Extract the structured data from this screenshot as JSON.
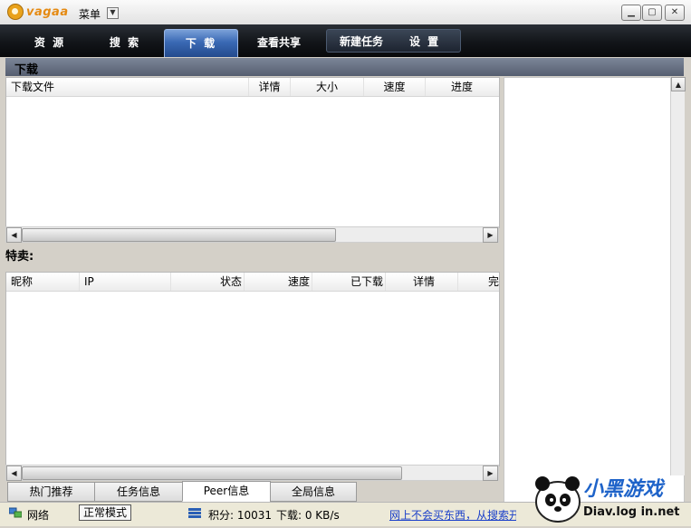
{
  "titlebar": {
    "logo_text": "vagaa",
    "menu_label": "菜单"
  },
  "nav": {
    "tabs": [
      "资 源",
      "搜 索",
      "下 载",
      "查看共享"
    ],
    "active_index": 2,
    "actions": [
      "新建任务",
      "设 置"
    ]
  },
  "section": {
    "title": "下载"
  },
  "downloads": {
    "columns": [
      "下载文件",
      "详情",
      "大小",
      "速度",
      "进度"
    ]
  },
  "special": {
    "label": "特卖:"
  },
  "peers": {
    "columns": [
      "昵称",
      "IP",
      "状态",
      "速度",
      "已下载",
      "详情",
      "完"
    ]
  },
  "bottom_tabs": {
    "items": [
      "热门推荐",
      "任务信息",
      "Peer信息",
      "全局信息"
    ],
    "active_index": 2
  },
  "status": {
    "network": "网络",
    "mode": "正常模式",
    "points": "积分: 10031",
    "download": "下载: 0 KB/s",
    "ad_link": "网上不会买东西，从搜索开"
  },
  "watermark": {
    "text1": "小黑游戏",
    "text2": "Diav.log in.net"
  }
}
